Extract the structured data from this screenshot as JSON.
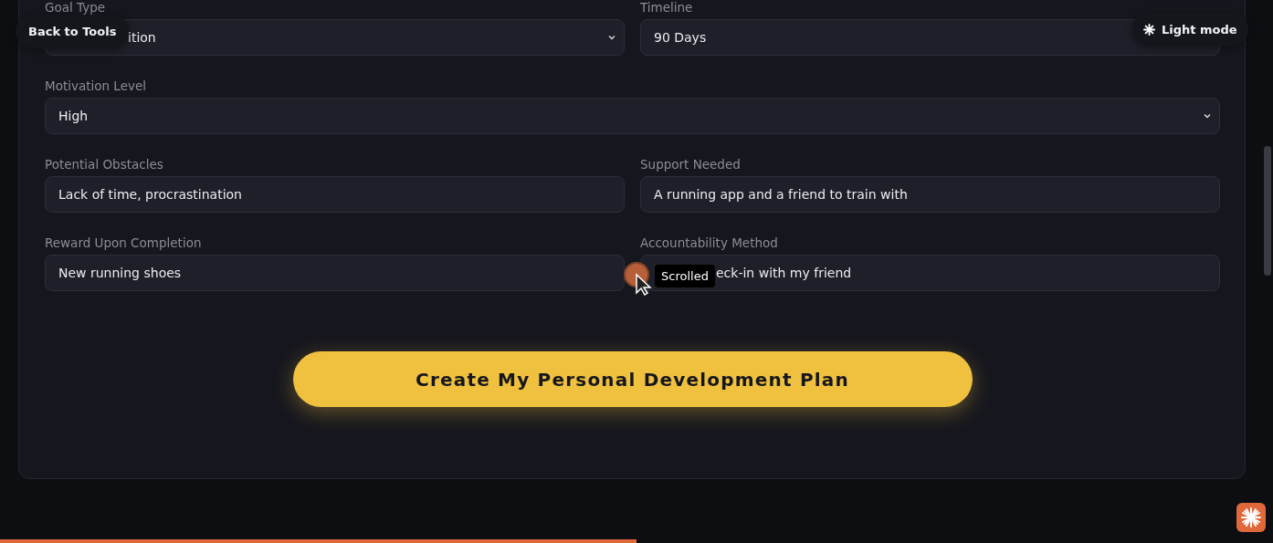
{
  "back_button": "Back to Tools",
  "theme_toggle": {
    "label": "Light mode"
  },
  "form": {
    "rows": [
      [
        {
          "label": "Goal Type",
          "kind": "select",
          "value": "ition"
        },
        {
          "label": "Timeline",
          "kind": "text",
          "value": "90 Days"
        }
      ],
      [
        {
          "label": "Motivation Level",
          "kind": "select",
          "value": "High"
        }
      ],
      [
        {
          "label": "Potential Obstacles",
          "kind": "text",
          "value": "Lack of time, procrastination"
        },
        {
          "label": "Support Needed",
          "kind": "text",
          "value": "A running app and a friend to train with"
        }
      ],
      [
        {
          "label": "Reward Upon Completion",
          "kind": "text",
          "value": "New running shoes"
        },
        {
          "label": "Accountability Method",
          "kind": "text",
          "value": "eck-in with my friend"
        }
      ]
    ],
    "submit_button": "Create My Personal Development Plan"
  },
  "tooltip": "Scrolled",
  "progress": {
    "level": 0.5
  }
}
